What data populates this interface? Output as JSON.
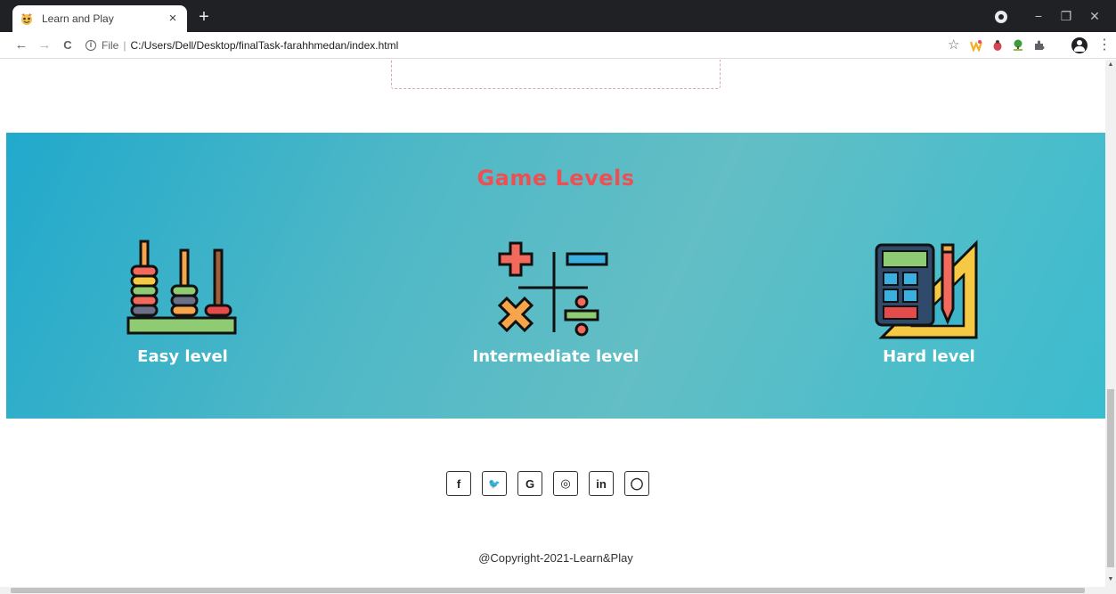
{
  "browser": {
    "tab_title": "Learn and Play",
    "tab_close": "×",
    "new_tab": "+",
    "url_scheme": "File",
    "url_separator": "|",
    "url": "C:/Users/Dell/Desktop/finalTask-farahhmedan/index.html",
    "window_controls": {
      "minimize": "−",
      "restore": "❐",
      "close": "✕"
    },
    "nav": {
      "back": "←",
      "forward": "→",
      "reload": "C"
    },
    "bookmark_star": "☆",
    "menu": "⋮"
  },
  "levels_section": {
    "title": "Game Levels",
    "items": [
      {
        "label": "Easy level",
        "icon": "abacus-icon"
      },
      {
        "label": "Intermediate level",
        "icon": "math-operators-icon"
      },
      {
        "label": "Hard level",
        "icon": "calculator-ruler-icon"
      }
    ]
  },
  "social": [
    {
      "name": "facebook",
      "glyph": "f"
    },
    {
      "name": "twitter",
      "glyph": "🐦"
    },
    {
      "name": "google",
      "glyph": "G"
    },
    {
      "name": "instagram",
      "glyph": "◎"
    },
    {
      "name": "linkedin",
      "glyph": "in"
    },
    {
      "name": "github",
      "glyph": "◯"
    }
  ],
  "footer": {
    "copyright": "@Copyright-2021-Learn&Play"
  },
  "colors": {
    "accent_title": "#ee4f53",
    "section_bg": "#3db4c9",
    "chrome_dark": "#202124"
  }
}
